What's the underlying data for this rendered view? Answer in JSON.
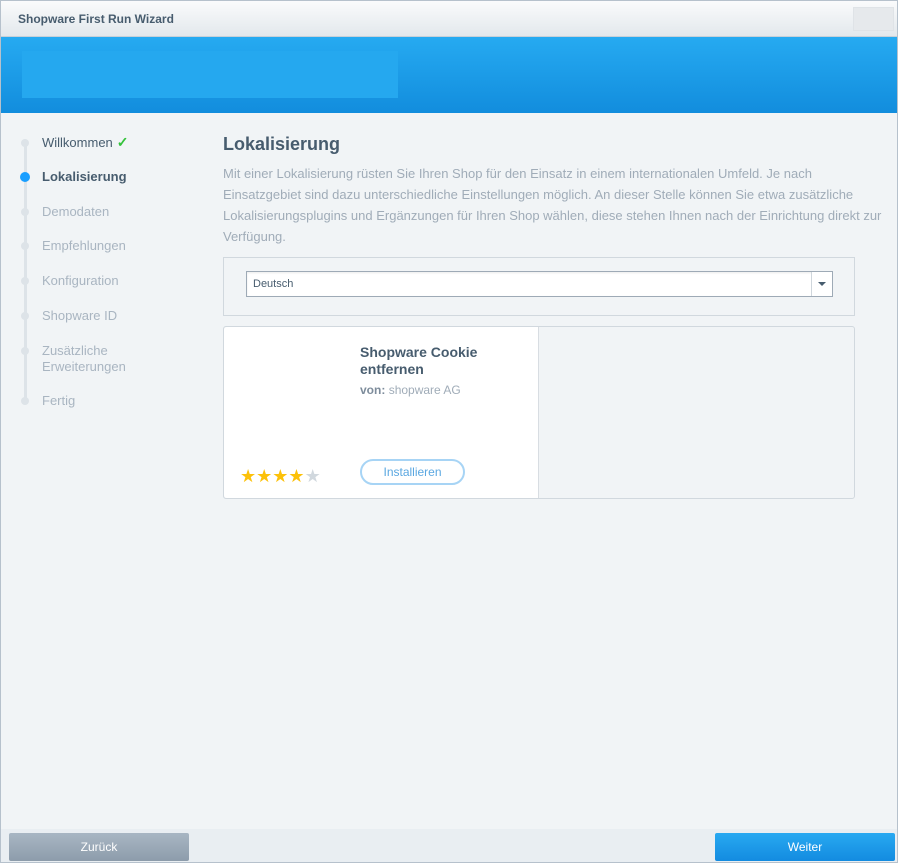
{
  "window": {
    "title": "Shopware First Run Wizard"
  },
  "sidebar": {
    "items": [
      {
        "label": "Willkommen",
        "state": "done"
      },
      {
        "label": "Lokalisierung",
        "state": "active"
      },
      {
        "label": "Demodaten",
        "state": "pending"
      },
      {
        "label": "Empfehlungen",
        "state": "pending"
      },
      {
        "label": "Konfiguration",
        "state": "pending"
      },
      {
        "label": "Shopware ID",
        "state": "pending"
      },
      {
        "label": "Zusätzliche Erweiterungen",
        "state": "pending"
      },
      {
        "label": "Fertig",
        "state": "pending"
      }
    ],
    "check_glyph": "✓"
  },
  "main": {
    "heading": "Lokalisierung",
    "intro": "Mit einer Lokalisierung rüsten Sie Ihren Shop für den Einsatz in einem internationalen Umfeld. Je nach Einsatzgebiet sind dazu unterschiedliche Einstellungen möglich. An dieser Stelle können Sie etwa zusätzliche Lokalisierungsplugins und Ergänzungen für Ihren Shop wählen, diese stehen Ihnen nach der Einrichtung direkt zur Verfügung.",
    "language_select": {
      "value": "Deutsch"
    },
    "plugin": {
      "name": "Shopware Cookie entfernen",
      "vendor_label": "von:",
      "vendor": "shopware AG",
      "rating": 4,
      "rating_max": 5,
      "install_label": "Installieren"
    }
  },
  "footer": {
    "back_label": "Zurück",
    "next_label": "Weiter"
  },
  "colors": {
    "accent": "#189eff",
    "banner": "#26aaf1",
    "check": "#34c23b",
    "star": "#fcc10a"
  }
}
